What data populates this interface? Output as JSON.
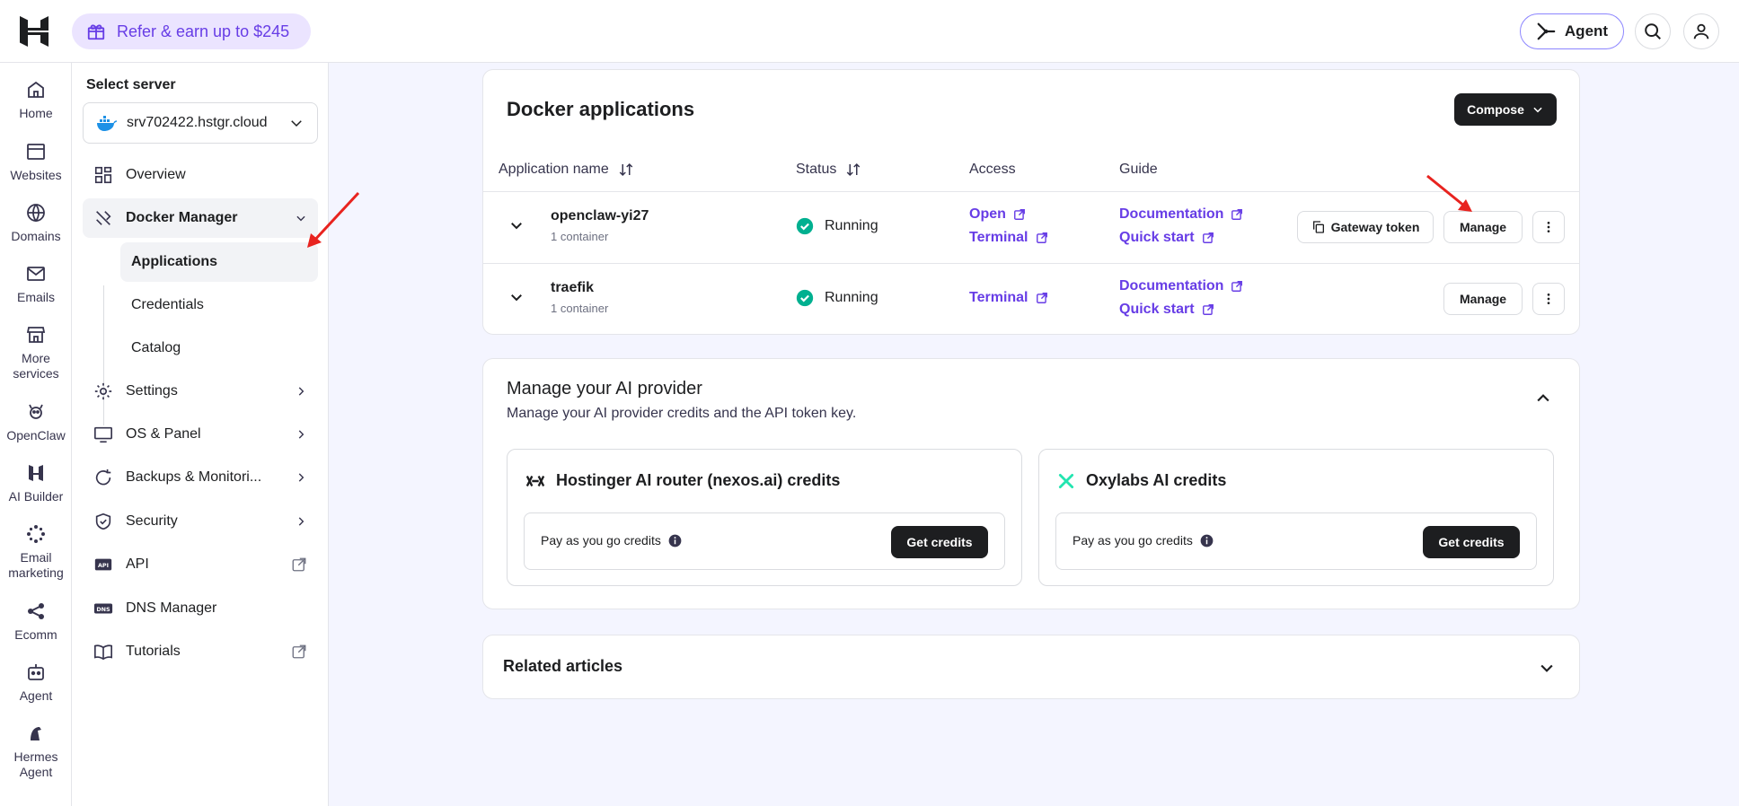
{
  "topbar": {
    "refer_label": "Refer & earn up to $245",
    "agent_label": "Agent"
  },
  "rail": [
    {
      "label": "Home",
      "icon": "home-icon"
    },
    {
      "label": "Websites",
      "icon": "websites-icon"
    },
    {
      "label": "Domains",
      "icon": "globe-icon"
    },
    {
      "label": "Emails",
      "icon": "mail-icon"
    },
    {
      "label": "More services",
      "icon": "store-icon"
    },
    {
      "label": "OpenClaw",
      "icon": "openclaw-icon"
    },
    {
      "label": "AI Builder",
      "icon": "ai-builder-icon"
    },
    {
      "label": "Email marketing",
      "icon": "email-marketing-icon"
    },
    {
      "label": "Ecomm",
      "icon": "ecomm-icon"
    },
    {
      "label": "Agent",
      "icon": "agent-icon"
    },
    {
      "label": "Hermes Agent",
      "icon": "hermes-icon"
    }
  ],
  "sidebar": {
    "title": "Select server",
    "server": "srv702422.hstgr.cloud",
    "items": {
      "overview": "Overview",
      "docker": "Docker Manager",
      "applications": "Applications",
      "credentials": "Credentials",
      "catalog": "Catalog",
      "settings": "Settings",
      "os_panel": "OS & Panel",
      "backups": "Backups & Monitori...",
      "security": "Security",
      "api": "API",
      "dns": "DNS Manager",
      "tutorials": "Tutorials"
    }
  },
  "docker": {
    "title": "Docker applications",
    "compose_label": "Compose",
    "columns": {
      "name": "Application name",
      "status": "Status",
      "access": "Access",
      "guide": "Guide"
    },
    "apps": [
      {
        "name": "openclaw-yi27",
        "sub": "1 container",
        "status": "Running",
        "access": [
          "Open",
          "Terminal"
        ],
        "guide": [
          "Documentation",
          "Quick start"
        ],
        "gateway_label": "Gateway token",
        "manage_label": "Manage"
      },
      {
        "name": "traefik",
        "sub": "1 container",
        "status": "Running",
        "access": [
          "Terminal"
        ],
        "guide": [
          "Documentation",
          "Quick start"
        ],
        "manage_label": "Manage"
      }
    ]
  },
  "ai": {
    "title": "Manage your AI provider",
    "subtitle": "Manage your AI provider credits and the API token key.",
    "providers": [
      {
        "name": "Hostinger AI router (nexos.ai) credits",
        "pay_label": "Pay as you go credits",
        "button": "Get credits"
      },
      {
        "name": "Oxylabs AI credits",
        "pay_label": "Pay as you go credits",
        "button": "Get credits"
      }
    ]
  },
  "related": {
    "title": "Related articles"
  },
  "colors": {
    "accent": "#673de6",
    "running": "#00b090",
    "dark_button": "#1d1e20",
    "annotation_arrow": "#e8231f"
  }
}
